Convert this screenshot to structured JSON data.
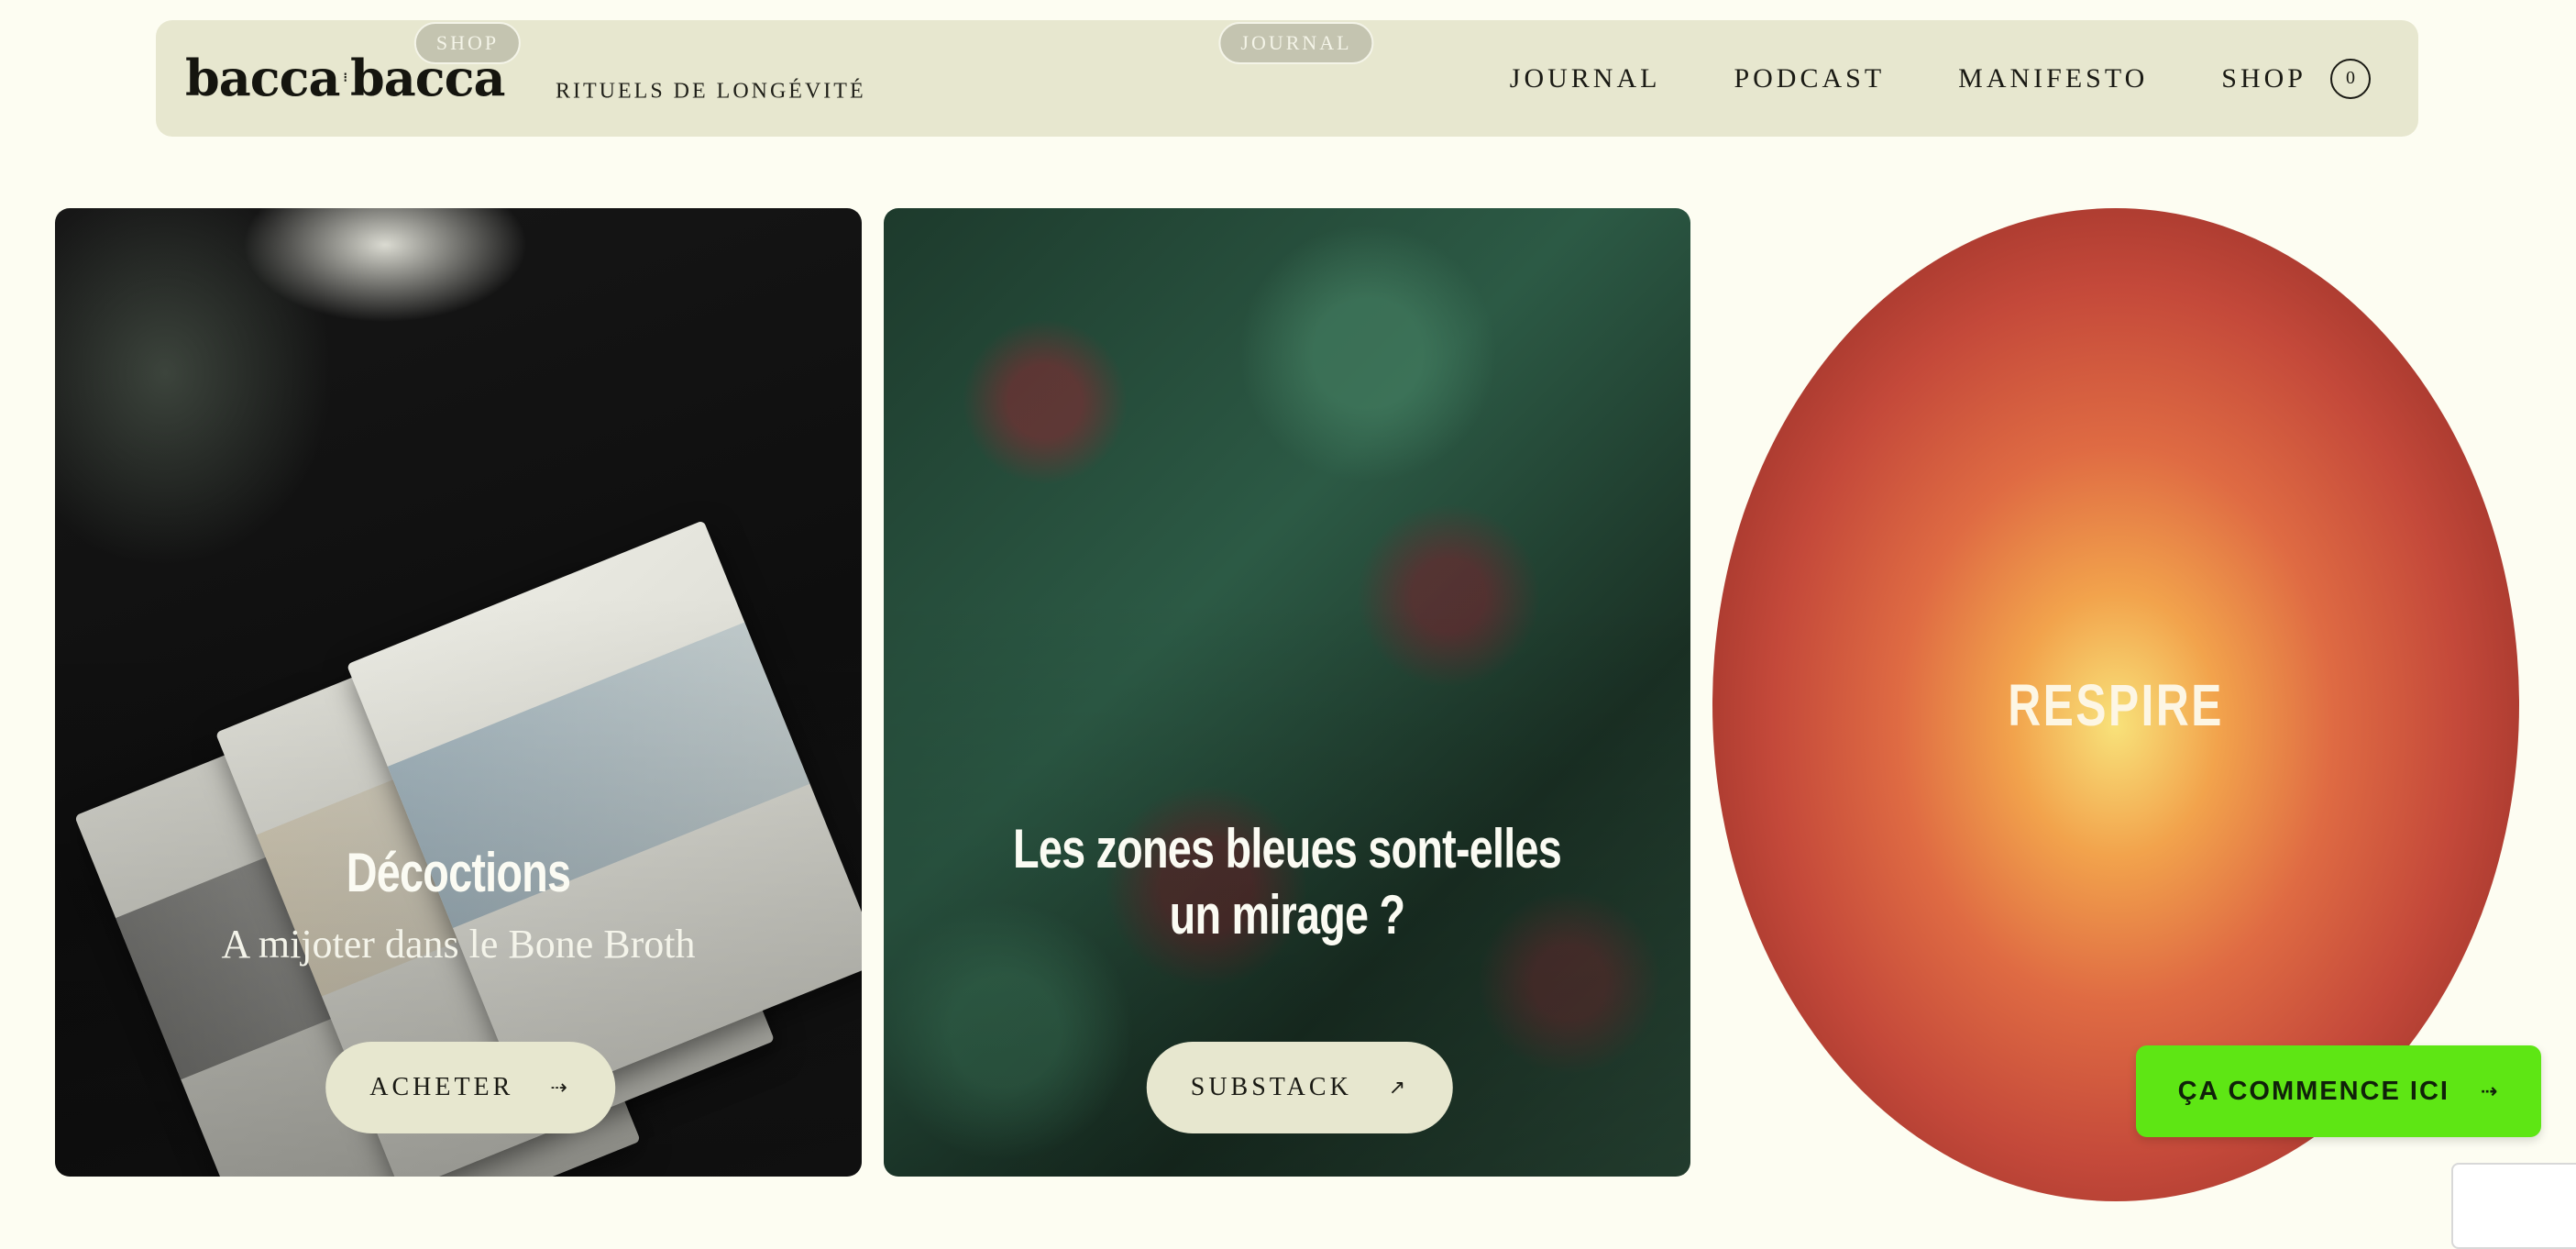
{
  "header": {
    "logo": {
      "left": "bacca",
      "right": "bacca",
      "separator": "⁝"
    },
    "tagline": "RITUELS DE LONGÉVITÉ",
    "nav": [
      "JOURNAL",
      "PODCAST",
      "MANIFESTO",
      "SHOP"
    ],
    "cart_count": "0"
  },
  "cards": [
    {
      "tag": "SHOP",
      "title": "Décoctions",
      "subtitle": "A mijoter dans le Bone Broth",
      "cta": "ACHETER",
      "cta_icon": "arrow-right-icon"
    },
    {
      "tag": "JOURNAL",
      "title": "Les zones bleues sont-elles un mirage ?",
      "cta": "SUBSTACK",
      "cta_icon": "arrow-up-right-icon"
    }
  ],
  "breathe": {
    "label": "RESPIRE"
  },
  "floating_cta": {
    "label": "ÇA COMMENCE ICI",
    "icon": "arrow-right-icon",
    "color": "#5ee614"
  },
  "colors": {
    "background": "#fdfdf2",
    "header": "#e7e7cf",
    "button": "#e7e7cf"
  }
}
